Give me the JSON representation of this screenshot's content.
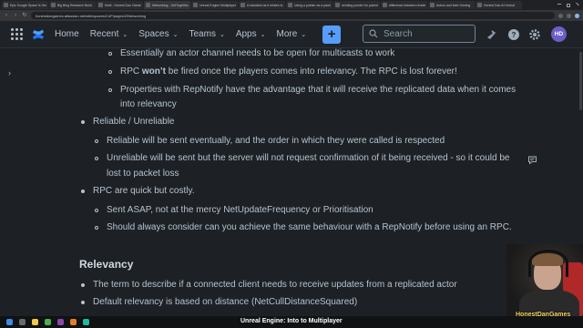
{
  "browser": {
    "tabs": [
      {
        "title": "Epic Google Space Is Here"
      },
      {
        "title": "Big Blog Research Build"
      },
      {
        "title": "Multi - Honest Dan Games"
      },
      {
        "title": "Networking - GetTogether"
      },
      {
        "title": "Unreal Engine Multiplayer"
      },
      {
        "title": "A standard as it relates to"
      },
      {
        "title": "Using a pointer as a parent"
      },
      {
        "title": "sending pointer for parent"
      },
      {
        "title": "difference between rendering"
      },
      {
        "title": "Actors and their Owning"
      },
      {
        "title": "Honest Dan AI Unreal"
      }
    ],
    "url": "honestdangames.atlassian.net/wiki/spaces/CnP/pages/2/Networking"
  },
  "header": {
    "nav": [
      {
        "label": "Home"
      },
      {
        "label": "Recent"
      },
      {
        "label": "Spaces"
      },
      {
        "label": "Teams"
      },
      {
        "label": "Apps"
      },
      {
        "label": "More"
      }
    ],
    "create_label": "+",
    "search_placeholder": "Search",
    "avatar_initials": "HD",
    "accent_color": "#579dff"
  },
  "content": {
    "lines": [
      "Essentially an actor channel needs to be open for multicasts to work",
      "RPC won’t be fired once the players comes into relevancy. The RPC is lost forever!",
      "Properties with RepNotify have the advantage that it will receive the replicated data when it comes",
      "into relevancy",
      "Reliable / Unreliable",
      "Reliable will be sent eventually, and the order in which they were called is respected",
      "Unreliable will be sent but the server will not request confirmation of it being received - so it could be",
      "lost to packet loss",
      "RPC are quick but costly.",
      "Sent ASAP, not at the mercy NetUpdateFrequency or Prioritisation",
      "Should always consider can you achieve the same behaviour with a RepNotify before using an RPC.",
      "The term to describe if a connected client needs to receive updates from a replicated actor",
      "Default relevancy is based on distance (NetCullDistanceSquared)"
    ],
    "line2_prefix": "RPC ",
    "line2_bold": "won’t",
    "line2_suffix": " be fired once the players comes into relevancy. The RPC is lost forever!",
    "section_heading": "Relevancy"
  },
  "overlay": {
    "streamer_label": "HonestDanGames",
    "stream_title": "Unreal Engine: Into to Multiplayer"
  }
}
